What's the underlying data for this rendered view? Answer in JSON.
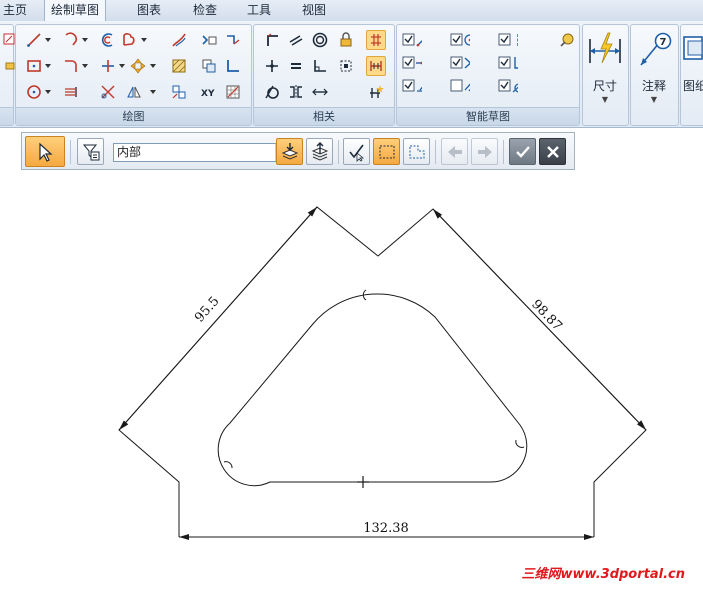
{
  "tabs": [
    "主页",
    "绘制草图",
    "图表",
    "检查",
    "工具",
    "视图"
  ],
  "active_tab": "绘制草图",
  "ribbon": {
    "groups": {
      "draw": "绘图",
      "relate": "相关",
      "intellisketch": "智能草图"
    },
    "big_buttons": {
      "dimension": "尺寸",
      "annotation": "注释",
      "drawing_view": "图纸"
    }
  },
  "command_bar": {
    "selection_filter": "内部"
  },
  "sketch": {
    "dimensions": {
      "left_edge": "95.5",
      "right_edge": "98.87",
      "bottom_width": "132.38"
    }
  },
  "watermark": "三维网www.3dportal.cn",
  "colors": {
    "highlight": "#ffd98a",
    "command_active": "#f5a942",
    "watermark": "#e0191d"
  }
}
